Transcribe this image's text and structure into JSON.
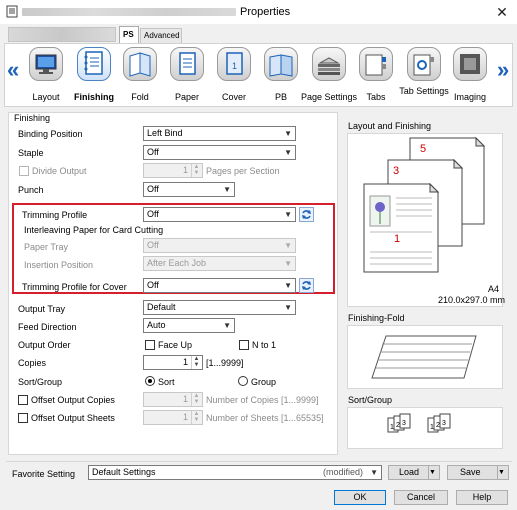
{
  "window": {
    "title": "Properties",
    "close_glyph": "✕"
  },
  "tabs": [
    {
      "label": "PS"
    },
    {
      "label": "Advanced"
    }
  ],
  "toolbar": {
    "prev_glyph": "«",
    "next_glyph": "»",
    "items": [
      {
        "label": "Layout",
        "icon": "monitor-icon"
      },
      {
        "label": "Finishing",
        "icon": "finishing-icon",
        "selected": true
      },
      {
        "label": "Fold",
        "icon": "fold-icon"
      },
      {
        "label": "Paper",
        "icon": "paper-icon"
      },
      {
        "label": "Cover",
        "icon": "cover-icon"
      },
      {
        "label": "PB",
        "icon": "book-icon"
      },
      {
        "label": "Page Settings",
        "icon": "page-settings-icon"
      },
      {
        "label": "Tabs",
        "icon": "tabs-icon"
      },
      {
        "label": "Tab Settings",
        "icon": "tab-settings-icon"
      },
      {
        "label": "Imaging",
        "icon": "imaging-icon"
      }
    ]
  },
  "finishing": {
    "group_label": "Finishing",
    "binding_position": {
      "label": "Binding Position",
      "value": "Left Bind"
    },
    "staple": {
      "label": "Staple",
      "value": "Off"
    },
    "divide_output": {
      "label": "Divide Output",
      "value": "1",
      "unit": "Pages per Section"
    },
    "punch": {
      "label": "Punch",
      "value": "Off"
    },
    "trimming_profile": {
      "label": "Trimming Profile",
      "value": "Off"
    },
    "interleaving": {
      "label": "Interleaving Paper for Card Cutting"
    },
    "paper_tray": {
      "label": "Paper Tray",
      "value": "Off"
    },
    "insertion_position": {
      "label": "Insertion Position",
      "value": "After Each Job"
    },
    "trimming_cover": {
      "label": "Trimming Profile for Cover",
      "value": "Off"
    },
    "output_tray": {
      "label": "Output Tray",
      "value": "Default"
    },
    "feed_direction": {
      "label": "Feed Direction",
      "value": "Auto"
    },
    "output_order": {
      "label": "Output Order",
      "face_up": "Face Up",
      "n_to_1": "N to 1"
    },
    "copies": {
      "label": "Copies",
      "value": "1",
      "range": "[1...9999]"
    },
    "sort_group": {
      "label": "Sort/Group",
      "sort": "Sort",
      "group": "Group"
    },
    "offset_copies": {
      "label": "Offset Output Copies",
      "value": "1",
      "unit": "Number of Copies [1...9999]"
    },
    "offset_sheets": {
      "label": "Offset Output Sheets",
      "value": "1",
      "unit": "Number of Sheets [1...65535]"
    }
  },
  "preview": {
    "layout_title": "Layout and Finishing",
    "page_numbers": [
      "5",
      "3",
      "1"
    ],
    "paper_size": "A4",
    "paper_dims": "210.0x297.0 mm",
    "fold_title": "Finishing-Fold",
    "sort_title": "Sort/Group",
    "sort_sheets": [
      "1",
      "2",
      "3",
      "1",
      "2",
      "3"
    ]
  },
  "favorite": {
    "label": "Favorite Setting",
    "value": "Default Settings",
    "state": "(modified)",
    "load": "Load",
    "save": "Save"
  },
  "footer": {
    "ok": "OK",
    "cancel": "Cancel",
    "help": "Help"
  },
  "colors": {
    "highlight_border": "#d51f2c",
    "accent": "#1d63b8"
  }
}
